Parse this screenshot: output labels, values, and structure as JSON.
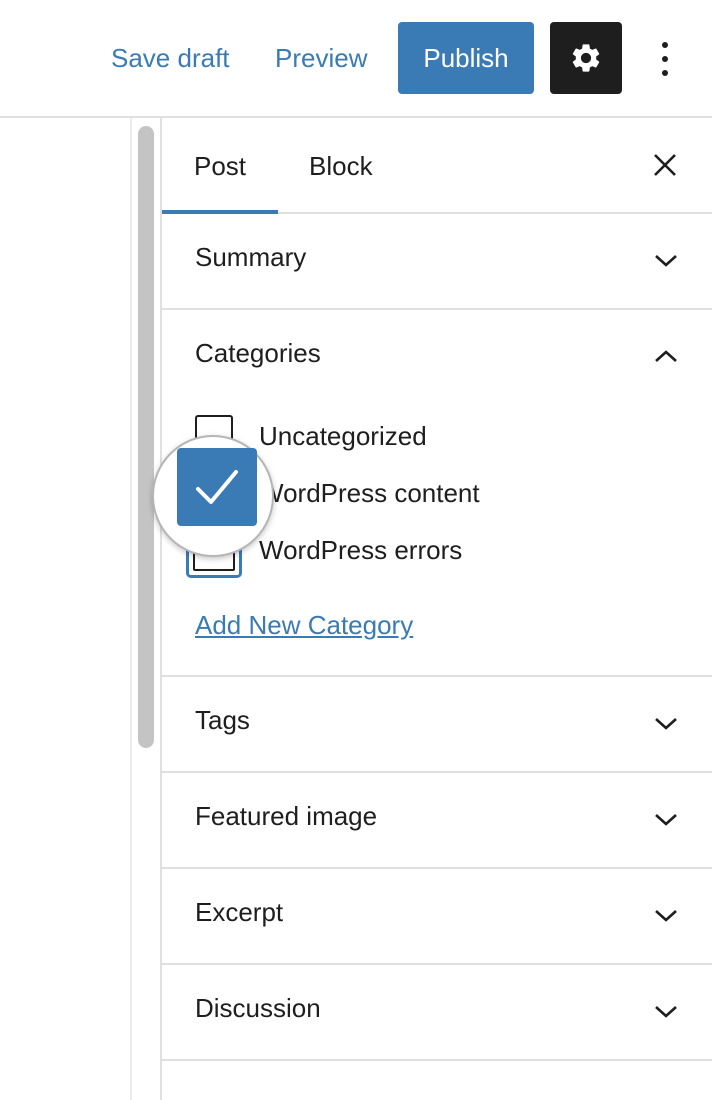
{
  "toolbar": {
    "save_draft_label": "Save draft",
    "preview_label": "Preview",
    "publish_label": "Publish",
    "settings_icon": "gear-icon",
    "more_icon": "vertical-ellipsis-icon"
  },
  "sidebar": {
    "tabs": [
      {
        "label": "Post",
        "active": true
      },
      {
        "label": "Block",
        "active": false
      }
    ],
    "close_icon": "close-icon",
    "panels": {
      "summary": {
        "title": "Summary",
        "expanded": false
      },
      "categories": {
        "title": "Categories",
        "expanded": true,
        "items": [
          {
            "label": "Uncategorized",
            "checked": false
          },
          {
            "label": "WordPress content",
            "checked": true
          },
          {
            "label": "WordPress errors",
            "checked": false
          }
        ],
        "add_new_label": "Add New Category"
      },
      "tags": {
        "title": "Tags",
        "expanded": false
      },
      "featured_image": {
        "title": "Featured image",
        "expanded": false
      },
      "excerpt": {
        "title": "Excerpt",
        "expanded": false
      },
      "discussion": {
        "title": "Discussion",
        "expanded": false
      }
    }
  },
  "colors": {
    "accent": "#3a7bb5",
    "text": "#1e1e1e",
    "border": "#e0e0e0",
    "dark_button": "#1e1e1e"
  }
}
